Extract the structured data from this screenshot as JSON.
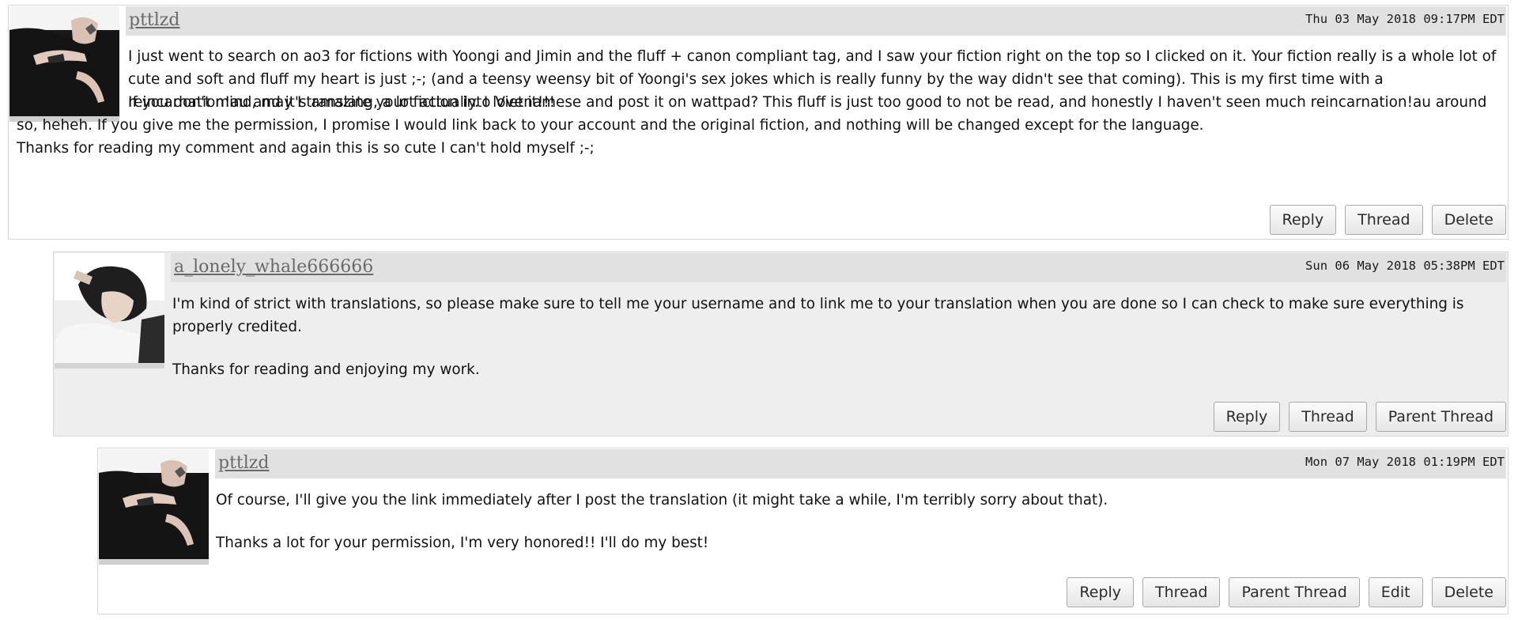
{
  "comments": [
    {
      "username": "pttlzd",
      "timestamp": "Thu 03 May 2018 09:17PM EDT",
      "avatar_icon": "user-avatar-photo-dark",
      "paragraphs": [
        "I just went to search on ao3 for fictions with Yoongi and Jimin and the fluff + canon compliant tag, and I saw your fiction right on the top so I clicked on it. Your fiction really is a whole lot of cute and soft and fluff my heart is just ;-; (and a teensy weensy bit of Yoongi's sex jokes which is really funny by the way didn't see that coming). This is my first time with a reincarnation!au and it's amazing, a lot actually. I love it!!!",
        "If you don't mind, may I translate your fiction into Vietnamese and post it on wattpad? This fluff is just too good to not be read, and honestly I haven't seen much reincarnation!au around so, heheh. If you give me the permission, I promise I would link back to your account and the original fiction, and nothing will be changed except for the language.",
        "Thanks for reading my comment and again this is so cute I can't hold myself ;-;"
      ],
      "buttons": [
        "Reply",
        "Thread",
        "Delete"
      ]
    },
    {
      "username": "a_lonely_whale666666",
      "timestamp": "Sun 06 May 2018 05:38PM EDT",
      "avatar_icon": "user-avatar-photo-light",
      "paragraphs": [
        "I'm kind of strict with translations, so please make sure to tell me your username and to link me to your translation when you are done so I can check to make sure everything is properly credited.",
        "Thanks for reading and enjoying my work."
      ],
      "buttons": [
        "Reply",
        "Thread",
        "Parent Thread"
      ]
    },
    {
      "username": "pttlzd",
      "timestamp": "Mon 07 May 2018 01:19PM EDT",
      "avatar_icon": "user-avatar-photo-dark",
      "paragraphs": [
        "Of course, I'll give you the link immediately after I post the translation (it might take a while, I'm terribly sorry about that).",
        "Thanks a lot for your permission, I'm very honored!! I'll do my best!"
      ],
      "buttons": [
        "Reply",
        "Thread",
        "Parent Thread",
        "Edit",
        "Delete"
      ]
    }
  ],
  "colors": {
    "header_bar": "#e1e1e1",
    "grey_comment_bg": "#eeeeee",
    "light_comment_bg": "#ffffff",
    "username": "#6a6a6a"
  }
}
